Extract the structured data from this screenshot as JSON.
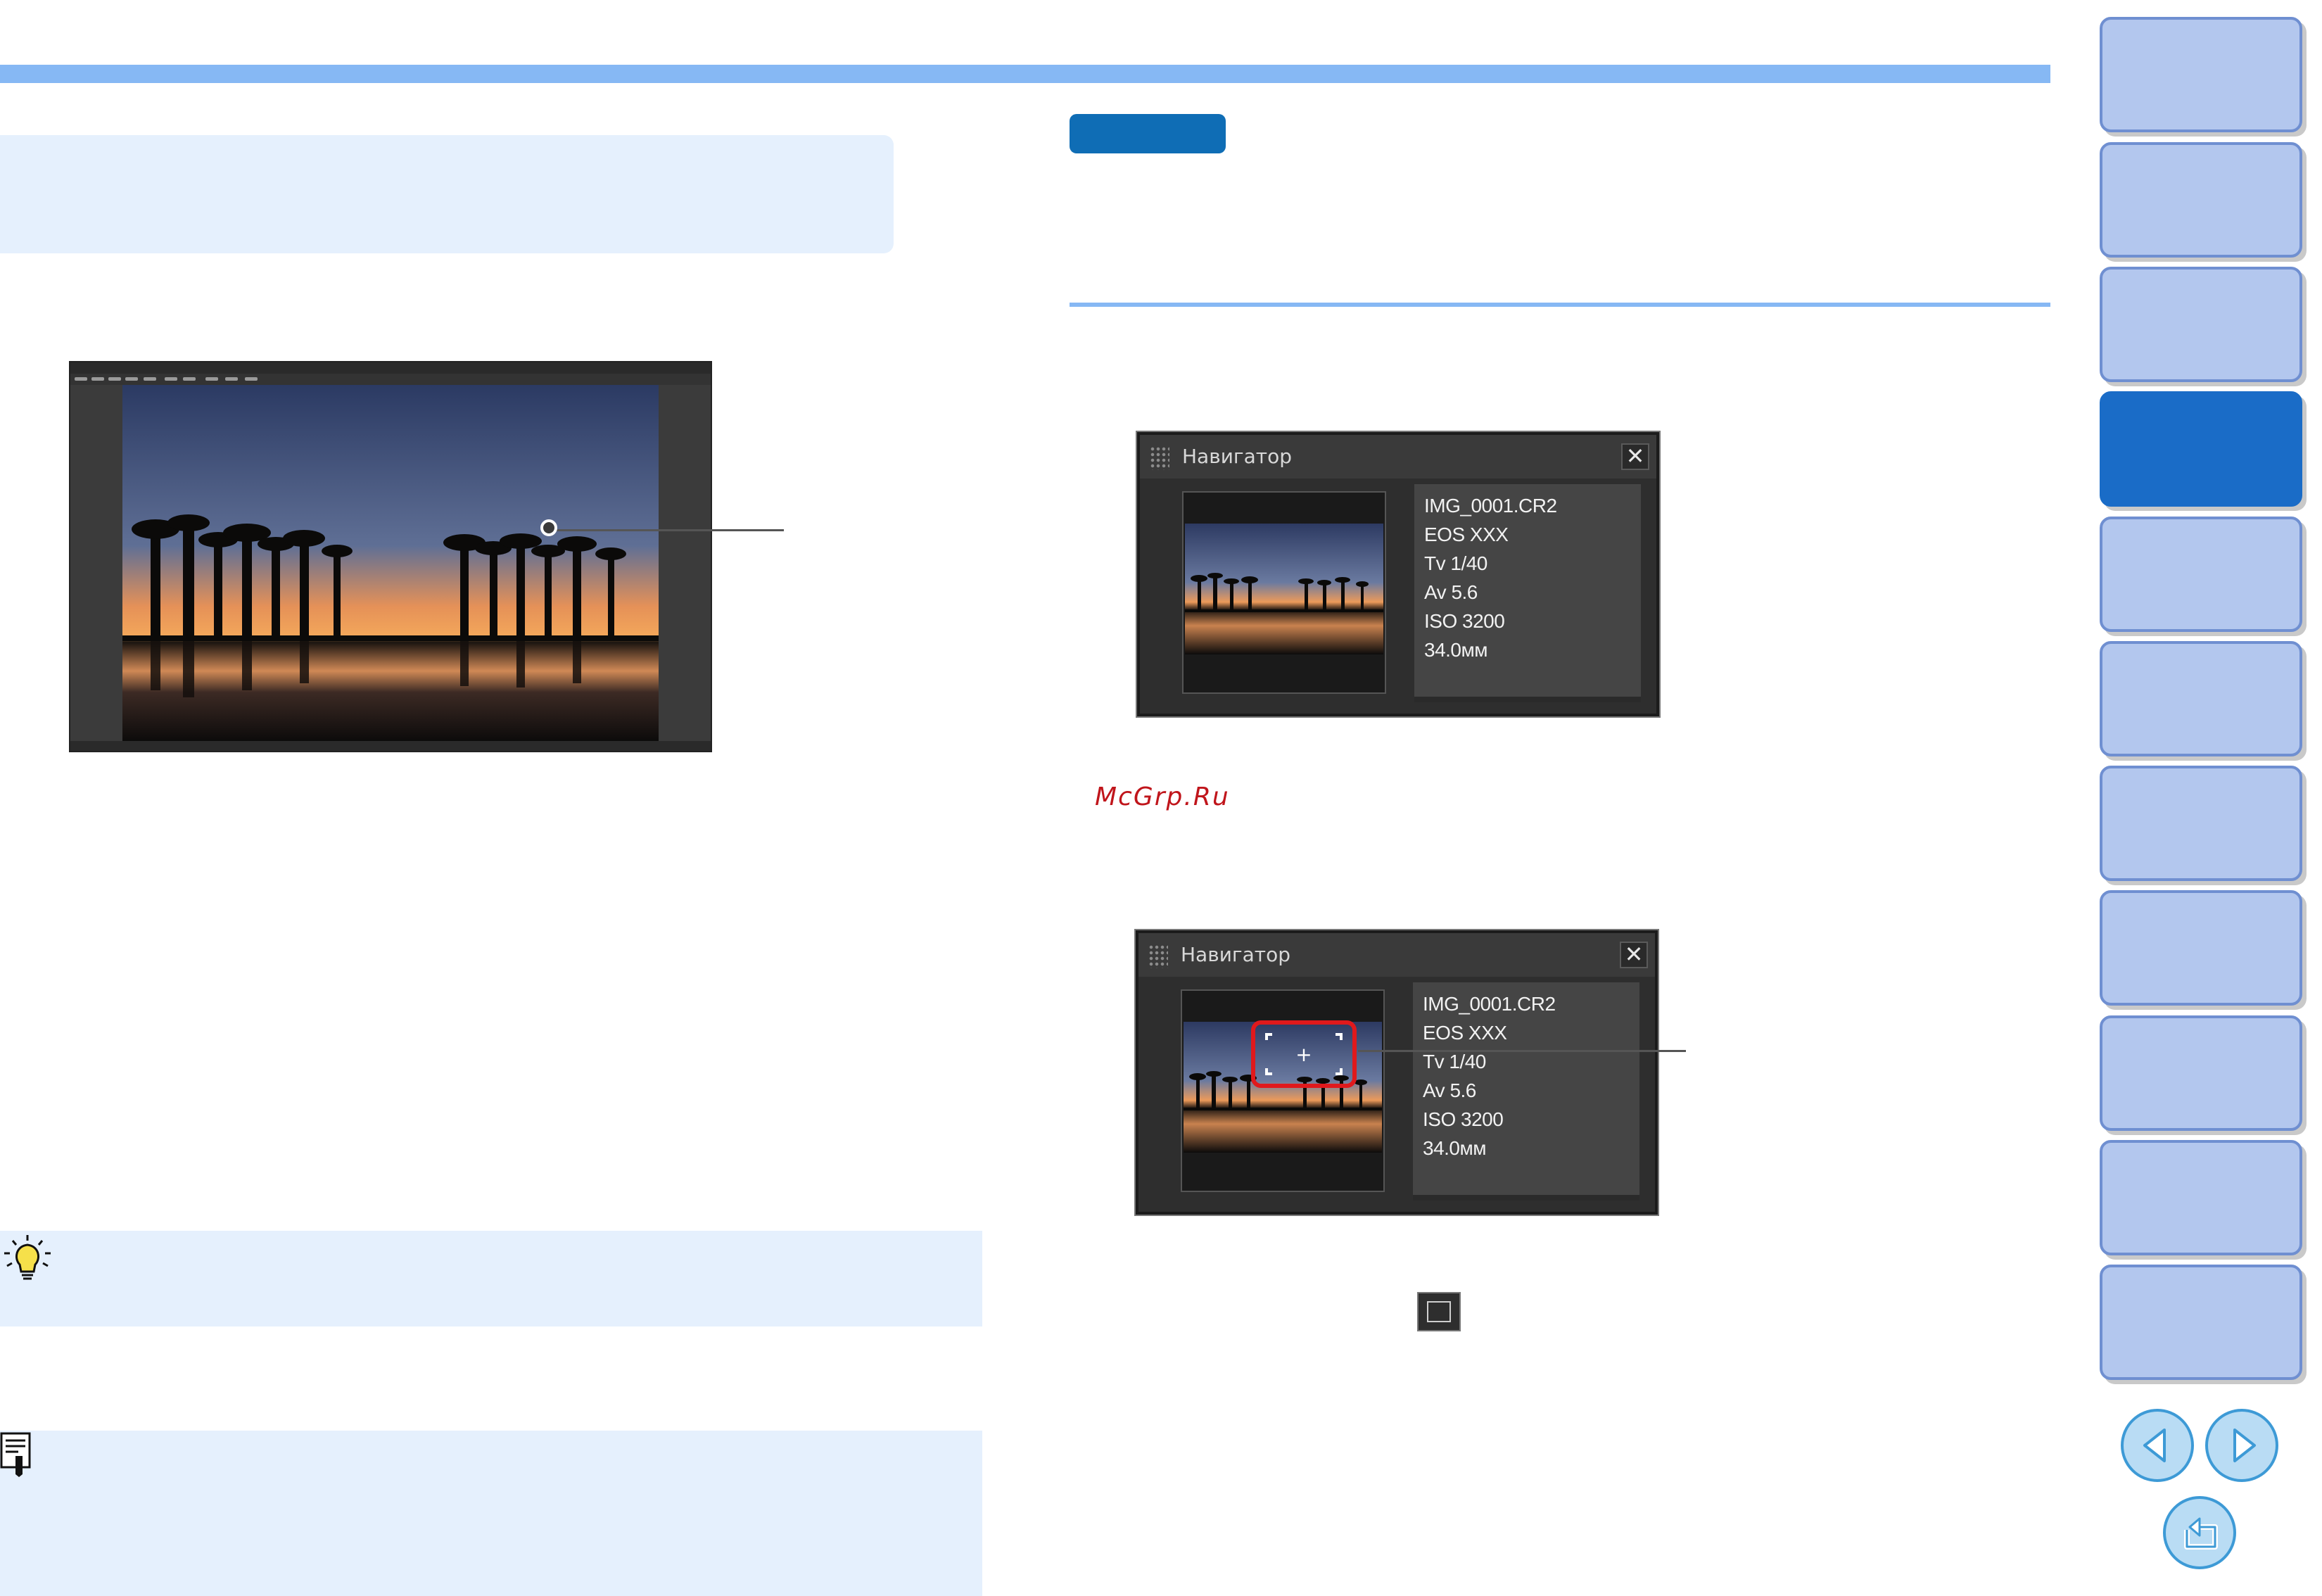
{
  "watermark": "McGrp.Ru",
  "colors": {
    "accent_bar": "#86b8f4",
    "panel_bg": "#e5f0fd",
    "badge": "#0f6db5",
    "active_tab": "#1a6cc7",
    "tab": "#b3c7ee",
    "highlight": "#e0191c"
  },
  "icons": {
    "tip": "lightbulb-icon",
    "note": "memo-icon",
    "close": "close-icon",
    "grip": "grip-icon",
    "prev": "arrow-left-icon",
    "next": "arrow-right-icon",
    "return": "return-icon",
    "fit": "fit-to-screen-icon"
  },
  "navigator_panels": [
    {
      "title": "Навигатор",
      "close_glyph": "✕",
      "info": [
        "IMG_0001.CR2",
        "EOS XXX",
        "Tv 1/40",
        "Av 5.6",
        "ISO 3200",
        "34.0мм"
      ]
    },
    {
      "title": "Навигатор",
      "close_glyph": "✕",
      "focus_mark": "+",
      "info": [
        "IMG_0001.CR2",
        "EOS XXX",
        "Tv 1/40",
        "Av 5.6",
        "ISO 3200",
        "34.0мм"
      ]
    }
  ],
  "sidebar": {
    "tab_count": 11,
    "active_index": 3
  }
}
